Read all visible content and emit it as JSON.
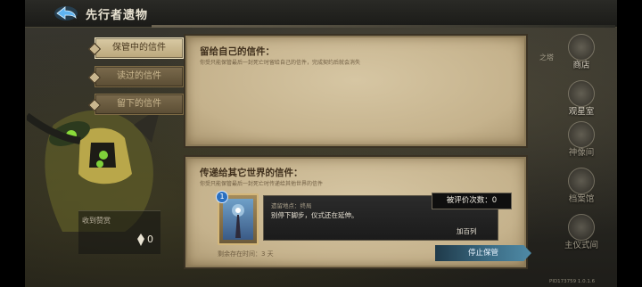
{
  "header": {
    "title": "先行者遗物"
  },
  "tabs": [
    {
      "label": "保管中的信件",
      "active": true
    },
    {
      "label": "读过的信件",
      "active": false
    },
    {
      "label": "留下的信件",
      "active": false
    }
  ],
  "panel_own": {
    "title": "留给自己的信件：",
    "subtitle": "你受只能保管最后一封死亡时留给自己的信件，完成契约后就会消失"
  },
  "panel_other": {
    "title": "传递给其它世界的信件：",
    "subtitle": "你受只能保管最后一封死亡时传递给其他世界的信件",
    "card_badge": "1",
    "message_place": "遗留地点：终局",
    "message_text": "别停下脚步，仪式还在延伸。",
    "eval_label": "被评价次数：0",
    "add_friend": "加百列",
    "remain_time": "剩余存在时间：3 天"
  },
  "stop_button": {
    "label": "停止保管"
  },
  "likes": {
    "label": "收到赞赏",
    "value": "0"
  },
  "right_nav": {
    "partial": "之塔",
    "items": [
      {
        "label": "商店",
        "icon": "shop-icon",
        "dim": false
      },
      {
        "label": "观星室",
        "icon": "telescope-icon",
        "dim": false
      },
      {
        "label": "神像间",
        "icon": "statue-icon",
        "dim": true
      },
      {
        "label": "档案馆",
        "icon": "archive-icon",
        "dim": true
      },
      {
        "label": "主仪式间",
        "icon": "ritual-icon",
        "dim": true
      }
    ]
  },
  "version": "PID173759  1.0.1.6",
  "colors": {
    "parchment": "#cdbb97",
    "accent_blue": "#3d6f88",
    "dark_panel": "#1b1b1b"
  }
}
